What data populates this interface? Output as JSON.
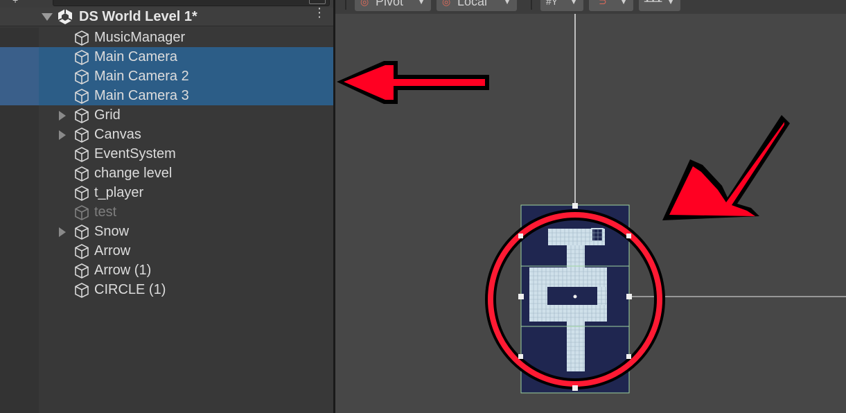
{
  "hierarchy": {
    "scene_name": "DS World Level 1*",
    "items": [
      {
        "label": "MusicManager",
        "selected": false,
        "disabled": false,
        "has_children": false
      },
      {
        "label": "Main Camera",
        "selected": true,
        "disabled": false,
        "has_children": false
      },
      {
        "label": "Main Camera 2",
        "selected": true,
        "disabled": false,
        "has_children": false
      },
      {
        "label": "Main Camera 3",
        "selected": true,
        "disabled": false,
        "has_children": false
      },
      {
        "label": "Grid",
        "selected": false,
        "disabled": false,
        "has_children": true
      },
      {
        "label": "Canvas",
        "selected": false,
        "disabled": false,
        "has_children": true
      },
      {
        "label": "EventSystem",
        "selected": false,
        "disabled": false,
        "has_children": false
      },
      {
        "label": "change level",
        "selected": false,
        "disabled": false,
        "has_children": false
      },
      {
        "label": "t_player",
        "selected": false,
        "disabled": false,
        "has_children": false
      },
      {
        "label": "test",
        "selected": false,
        "disabled": true,
        "has_children": false
      },
      {
        "label": "Snow",
        "selected": false,
        "disabled": false,
        "has_children": true
      },
      {
        "label": "Arrow",
        "selected": false,
        "disabled": false,
        "has_children": false
      },
      {
        "label": "Arrow (1)",
        "selected": false,
        "disabled": false,
        "has_children": false
      },
      {
        "label": "CIRCLE (1)",
        "selected": false,
        "disabled": false,
        "has_children": false
      }
    ]
  },
  "scene_toolbar": {
    "pivot_label": "Pivot",
    "local_label": "Local"
  },
  "colors": {
    "selection": "#2c5d87",
    "arrow_red": "#ff0022",
    "circle_red": "#ff1a33",
    "tile_blue": "#1f2650",
    "tile_light": "#cfe0ea"
  }
}
